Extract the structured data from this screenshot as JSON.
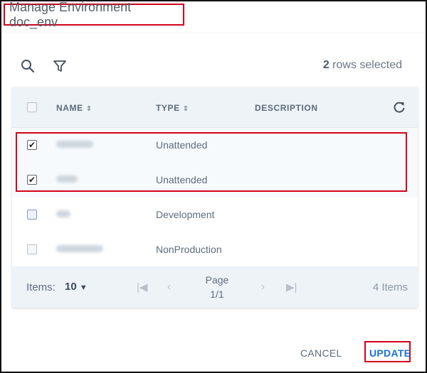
{
  "dialog": {
    "title": "Manage Environment doc_env"
  },
  "toolbar": {
    "search_icon": "search-icon",
    "filter_icon": "filter-icon",
    "selected_count": "2",
    "selected_suffix": " rows selected"
  },
  "table": {
    "columns": [
      {
        "label": "NAME",
        "sortable": true
      },
      {
        "label": "TYPE",
        "sortable": true
      },
      {
        "label": "DESCRIPTION",
        "sortable": false
      }
    ],
    "rows": [
      {
        "name": "",
        "type": "Unattended",
        "description": "",
        "selected": true
      },
      {
        "name": "",
        "type": "Unattended",
        "description": "",
        "selected": true
      },
      {
        "name": "",
        "type": "Development",
        "description": "",
        "selected": false
      },
      {
        "name": "",
        "type": "NonProduction",
        "description": "",
        "selected": false
      }
    ],
    "refresh_icon": "refresh-icon"
  },
  "footer": {
    "items_label": "Items:",
    "items_per_page": "10",
    "page_label": "Page",
    "page_value": "1/1",
    "total_items": "4 Items"
  },
  "actions": {
    "cancel": "CANCEL",
    "update": "UPDATE"
  },
  "colors": {
    "accent": "#1a73d9",
    "highlight_border": "#d0021b",
    "header_bg": "#eef3f8"
  }
}
